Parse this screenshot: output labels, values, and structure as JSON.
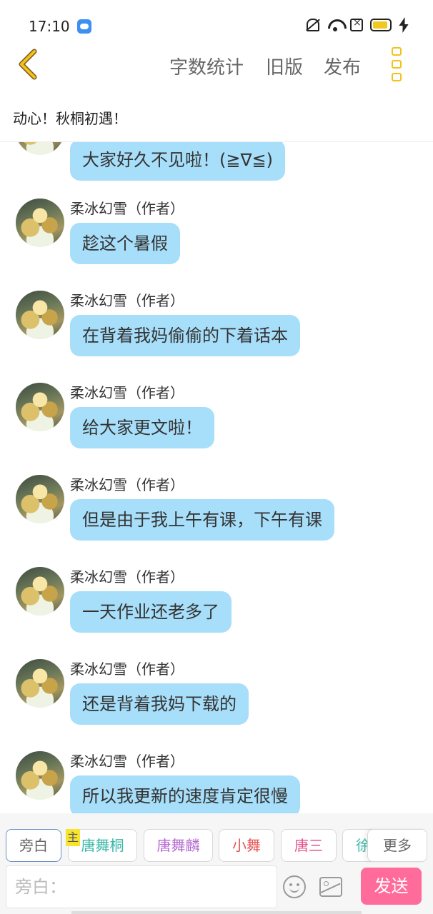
{
  "status": {
    "time": "17:10",
    "icons": [
      "app-notification-icon",
      "mute-icon",
      "wifi-icon",
      "sim-icon",
      "battery-icon",
      "charging-icon"
    ]
  },
  "nav": {
    "back": "back-chevron-icon",
    "word_count": "字数统计",
    "old_version": "旧版",
    "publish": "发布",
    "menu": "menu-icon"
  },
  "chapter_title": "动心！秋桐初遇！",
  "messages": [
    {
      "author": "",
      "text": "大家好久不见啦！(≧∇≦)"
    },
    {
      "author": "柔冰幻雪（作者）",
      "text": "趁这个暑假"
    },
    {
      "author": "柔冰幻雪（作者）",
      "text": "在背着我妈偷偷的下着话本"
    },
    {
      "author": "柔冰幻雪（作者）",
      "text": "给大家更文啦！"
    },
    {
      "author": "柔冰幻雪（作者）",
      "text": "但是由于我上午有课，下午有课"
    },
    {
      "author": "柔冰幻雪（作者）",
      "text": "一天作业还老多了"
    },
    {
      "author": "柔冰幻雪（作者）",
      "text": "还是背着我妈下载的"
    },
    {
      "author": "柔冰幻雪（作者）",
      "text": "所以我更新的速度肯定很慢"
    }
  ],
  "roles": {
    "narrator": "旁白",
    "main_badge": "主",
    "tangwutong": "唐舞桐",
    "tangwulin": "唐舞麟",
    "xiaowu": "小舞",
    "tangsan": "唐三",
    "xu": "徐",
    "more": "更多"
  },
  "composer": {
    "placeholder": "旁白：",
    "send": "发送"
  },
  "colors": {
    "bubble": "#a7def9",
    "accent_yellow": "#f3c21a",
    "send_pink": "#ff6b9a"
  }
}
